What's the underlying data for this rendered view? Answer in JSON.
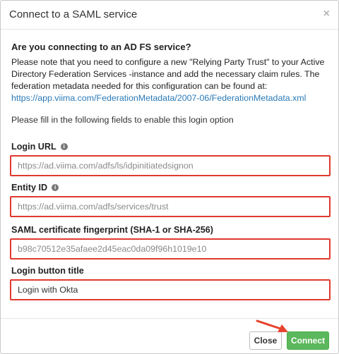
{
  "dialog": {
    "title": "Connect to a SAML service",
    "close_glyph": "×"
  },
  "intro": {
    "heading": "Are you connecting to an AD FS service?",
    "text": "Please note that you need to configure a new \"Relying Party Trust\" to your Active Directory Federation Services -instance and add the necessary claim rules. The federation metadata needed for this configuration can be found at:",
    "metadata_url": "https://app.viima.com/FederationMetadata/2007-06/FederationMetadata.xml"
  },
  "instruction": "Please fill in the following fields to enable this login option",
  "fields": {
    "login_url": {
      "label": "Login URL",
      "placeholder": "https://ad.viima.com/adfs/ls/idpinitiatedsignon",
      "value": ""
    },
    "entity_id": {
      "label": "Entity ID",
      "placeholder": "https://ad.viima.com/adfs/services/trust",
      "value": ""
    },
    "fingerprint": {
      "label": "SAML certificate fingerprint (SHA-1 or SHA-256)",
      "placeholder": "b98c70512e35afaee2d45eac0da09f96h1019e10",
      "value": ""
    },
    "button_title": {
      "label": "Login button title",
      "placeholder": "",
      "value": "Login with Okta"
    }
  },
  "footer": {
    "close_label": "Close",
    "connect_label": "Connect"
  },
  "colors": {
    "highlight_border": "#e03a2e",
    "connect_button": "#5cb85c",
    "link": "#2a7ab8"
  },
  "icons": {
    "info": "info-circle-icon",
    "close": "close-icon",
    "annotation": "red-arrow-icon"
  }
}
